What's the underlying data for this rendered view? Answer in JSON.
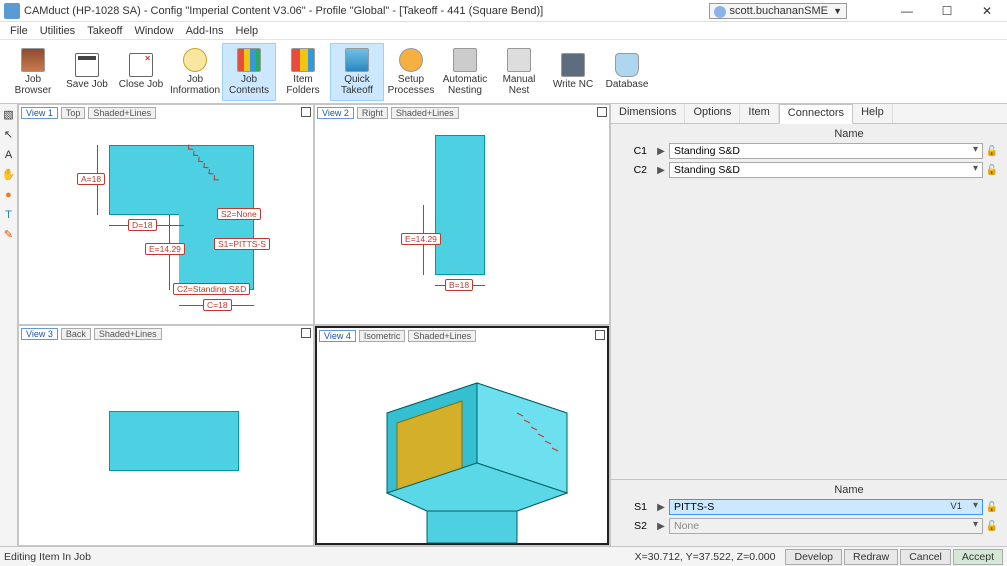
{
  "title": "CAMduct (HP-1028 SA) - Config \"Imperial Content V3.06\" - Profile \"Global\" - [Takeoff - 441 (Square Bend)]",
  "user": "scott.buchananSME",
  "menu": {
    "file": "File",
    "utilities": "Utilities",
    "takeoff": "Takeoff",
    "window": "Window",
    "addins": "Add-Ins",
    "help": "Help"
  },
  "toolbar": {
    "job_browser": "Job Browser",
    "save_job": "Save Job",
    "close_job": "Close Job",
    "job_information": "Job Information",
    "job_contents": "Job Contents",
    "item_folders": "Item Folders",
    "quick_takeoff": "Quick Takeoff",
    "setup_processes": "Setup Processes",
    "automatic_nesting": "Automatic Nesting",
    "manual_nest": "Manual Nest",
    "write_nc": "Write NC",
    "database": "Database"
  },
  "views": {
    "v1": {
      "name": "View 1",
      "mode1": "Top",
      "mode2": "Shaded+Lines"
    },
    "v2": {
      "name": "View 2",
      "mode1": "Right",
      "mode2": "Shaded+Lines"
    },
    "v3": {
      "name": "View 3",
      "mode1": "Back",
      "mode2": "Shaded+Lines"
    },
    "v4": {
      "name": "View 4",
      "mode1": "Isometric",
      "mode2": "Shaded+Lines"
    }
  },
  "dims": {
    "A": "A=18",
    "B": "B=18",
    "C": "C=18",
    "D": "D=18",
    "E1": "E=14.29",
    "E2": "E=14.29",
    "S1": "S1=PITTS-S",
    "S2": "S2=None",
    "C2": "C2=Standing S&D"
  },
  "tabs": {
    "dimensions": "Dimensions",
    "options": "Options",
    "item": "Item",
    "connectors": "Connectors",
    "help": "Help"
  },
  "conn_header": "Name",
  "connectors": {
    "c1": {
      "label": "C1",
      "value": "Standing S&D"
    },
    "c2": {
      "label": "C2",
      "value": "Standing S&D"
    }
  },
  "seam_header": "Name",
  "seams": {
    "s1": {
      "label": "S1",
      "value": "PITTS-S",
      "suffix": "V1"
    },
    "s2": {
      "label": "S2",
      "value": "None"
    }
  },
  "status": {
    "left": "Editing Item In Job",
    "coords": "X=30.712, Y=37.522, Z=0.000",
    "develop": "Develop",
    "redraw": "Redraw",
    "cancel": "Cancel",
    "accept": "Accept"
  }
}
